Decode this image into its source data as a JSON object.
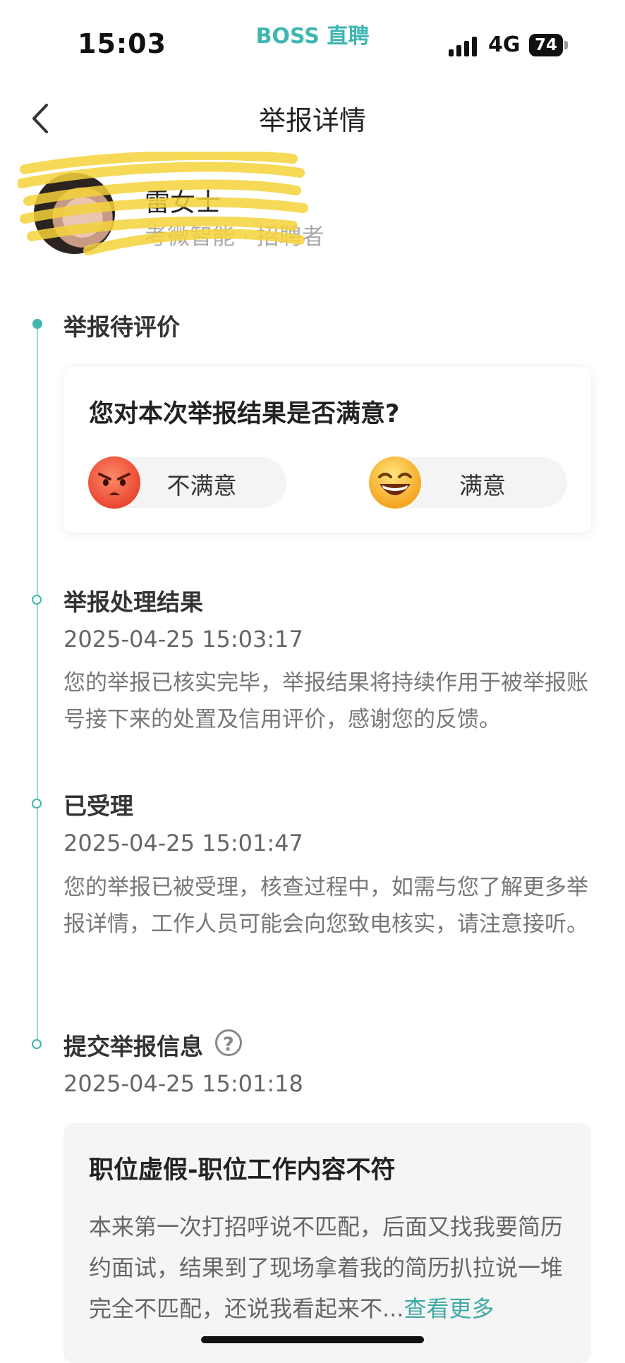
{
  "status_bar": {
    "time": "15:03",
    "brand": "BOSS 直聘",
    "network": "4G",
    "battery": "74"
  },
  "header": {
    "title": "举报详情"
  },
  "profile": {
    "name": "雷女士",
    "subtitle": "考微智能 · 招聘者"
  },
  "timeline": {
    "pending": {
      "title": "举报待评价",
      "question": "您对本次举报结果是否满意?",
      "dissatisfied_label": "不满意",
      "satisfied_label": "满意"
    },
    "result": {
      "title": "举报处理结果",
      "time": "2025-04-25 15:03:17",
      "desc": "您的举报已核实完毕，举报结果将持续作用于被举报账号接下来的处置及信用评价，感谢您的反馈。"
    },
    "accepted": {
      "title": "已受理",
      "time": "2025-04-25 15:01:47",
      "desc": "您的举报已被受理，核查过程中，如需与您了解更多举报详情，工作人员可能会向您致电核实，请注意接听。"
    },
    "submitted": {
      "title": "提交举报信息",
      "help_icon": "?",
      "time": "2025-04-25 15:01:18",
      "report_title": "职位虚假-职位工作内容不符",
      "report_desc": "本来第一次打招呼说不匹配，后面又找我要简历约面试，结果到了现场拿着我的简历扒拉说一堆完全不匹配，还说我看起来不...",
      "see_more": "查看更多"
    }
  },
  "colors": {
    "accent": "#3fb6b0",
    "link": "#3fa9a4"
  }
}
